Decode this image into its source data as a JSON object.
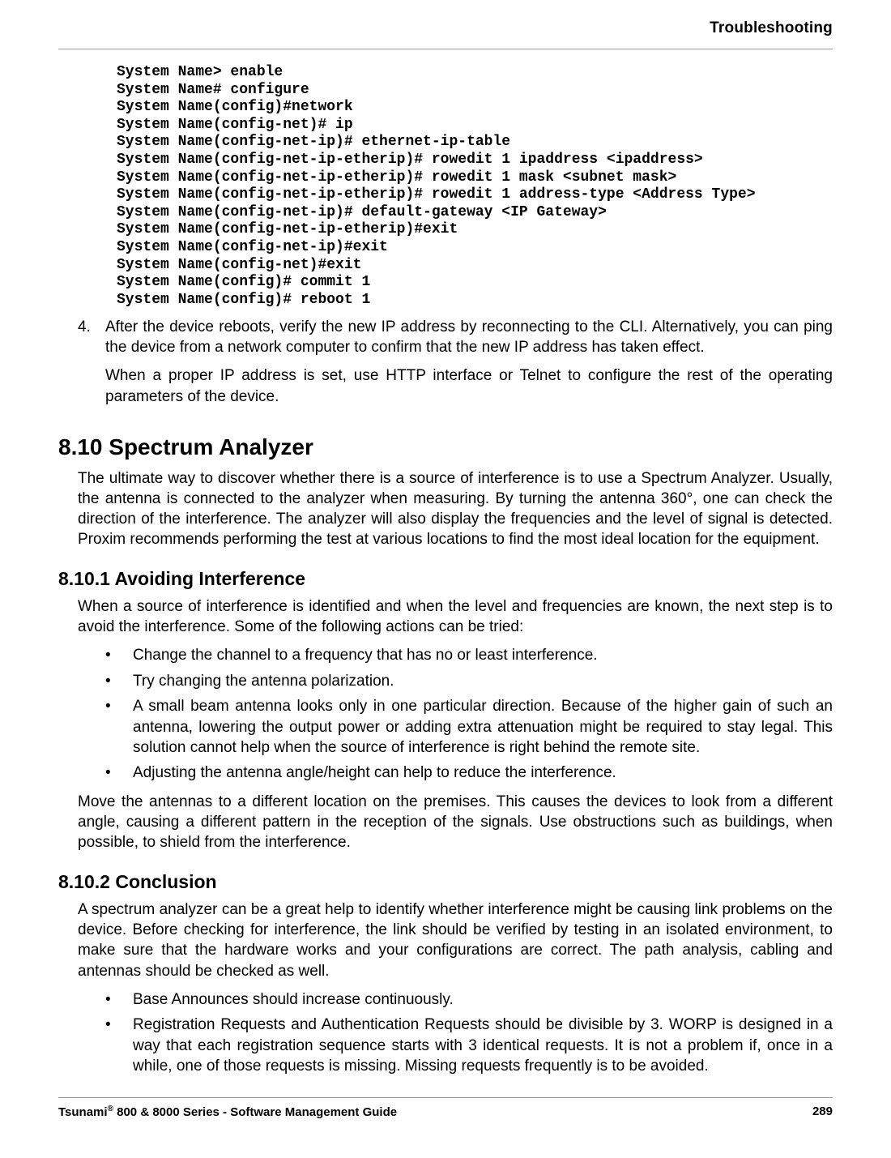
{
  "running_head": "Troubleshooting",
  "code_block": "System Name> enable\nSystem Name# configure\nSystem Name(config)#network\nSystem Name(config-net)# ip\nSystem Name(config-net-ip)# ethernet-ip-table\nSystem Name(config-net-ip-etherip)# rowedit 1 ipaddress <ipaddress>\nSystem Name(config-net-ip-etherip)# rowedit 1 mask <subnet mask>\nSystem Name(config-net-ip-etherip)# rowedit 1 address-type <Address Type>\nSystem Name(config-net-ip)# default-gateway <IP Gateway>\nSystem Name(config-net-ip-etherip)#exit\nSystem Name(config-net-ip)#exit\nSystem Name(config-net)#exit\nSystem Name(config)# commit 1\nSystem Name(config)# reboot 1",
  "step4": {
    "marker": "4.",
    "p1": "After the device reboots, verify the new IP address by reconnecting to the CLI. Alternatively, you can ping the device from a network computer to confirm that the new IP address has taken effect.",
    "p2": "When a proper IP address is set, use HTTP interface or Telnet to configure the rest of the operating parameters of the device."
  },
  "sec_8_10": {
    "heading": "8.10 Spectrum Analyzer",
    "p1": "The ultimate way to discover whether there is a source of interference is to use a Spectrum Analyzer. Usually, the antenna is connected to the analyzer when measuring. By turning the antenna 360°, one can check the direction of the interference. The analyzer will also display the frequencies and the level of signal is detected. Proxim recommends performing the test at various locations to find the most ideal location for the equipment."
  },
  "sec_8_10_1": {
    "heading": "8.10.1 Avoiding Interference",
    "p1": "When a source of interference is identified and when the level and frequencies are known, the next step is to avoid the interference. Some of the following actions can be tried:",
    "bullets": [
      "Change the channel to a frequency that has no or least interference.",
      "Try changing the antenna polarization.",
      "A small beam antenna looks only in one particular direction. Because of the higher gain of such an antenna, lowering the output power or adding extra attenuation might be required to stay legal. This solution cannot help when the source of interference is right behind the remote site.",
      "Adjusting the antenna angle/height can help to reduce the interference."
    ],
    "p2": "Move the antennas to a different location on the premises. This causes the devices to look from a different angle, causing a different pattern in the reception of the signals. Use obstructions such as buildings, when possible, to shield from the interference."
  },
  "sec_8_10_2": {
    "heading": "8.10.2 Conclusion",
    "p1": "A spectrum analyzer can be a great help to identify whether interference might be causing link problems on the device. Before checking for interference, the link should be verified by testing in an isolated environment, to make sure that the hardware works and your configurations are correct. The path analysis, cabling and antennas should be checked as well.",
    "bullets": [
      "Base Announces should increase continuously.",
      "Registration Requests and Authentication Requests should be divisible by 3. WORP is designed in a way that each registration sequence starts with 3 identical requests. It is not a problem if, once in a while, one of those requests is missing. Missing requests frequently is to be avoided."
    ]
  },
  "footer": {
    "left_pre": "Tsunami",
    "left_reg": "®",
    "left_post": " 800 & 8000 Series - Software Management Guide",
    "page": "289"
  }
}
